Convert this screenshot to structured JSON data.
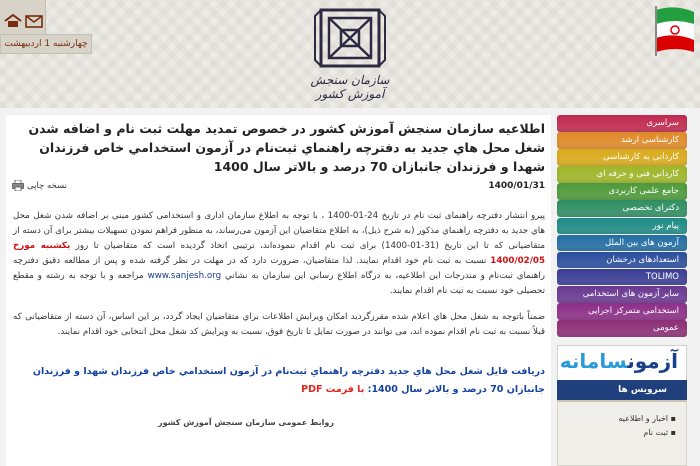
{
  "header": {
    "date": "چهارشنبه 1 اردیبهشت",
    "logo_text": "سازمان سنجش آموزش کشور",
    "icons": [
      "home-icon",
      "mail-icon",
      "flag-icon"
    ]
  },
  "sidebar": {
    "items": [
      {
        "label": "سراسری",
        "color": "#c12a50"
      },
      {
        "label": "کارشناسی ارشد",
        "color": "#e08a2a"
      },
      {
        "label": "کاردانی به کارشناسی",
        "color": "#d9aa1c"
      },
      {
        "label": "کاردانی فنی و حرفه ای",
        "color": "#9fb62a"
      },
      {
        "label": "جامع علمی کاربردی",
        "color": "#4e9a3a"
      },
      {
        "label": "دکترای تخصصی",
        "color": "#2f8f63"
      },
      {
        "label": "پیام نور",
        "color": "#1f8c86"
      },
      {
        "label": "آزمون های بین الملل",
        "color": "#246ea3"
      },
      {
        "label": "استعدادهای درخشان",
        "color": "#2b4f9e"
      },
      {
        "label": "TOLIMO",
        "color": "#3a3e94"
      },
      {
        "label": "سایر آزمون های استخدامی",
        "color": "#6a3a92"
      },
      {
        "label": "استخدامی متمرکز اجرایی",
        "color": "#8d2f88"
      },
      {
        "label": "عمومی",
        "color": "#8d2f78"
      }
    ],
    "ad_text_part1": "آزمون",
    "ad_text_part2": "سامانه",
    "services_title": "سرویس ها",
    "service_links": [
      "اخبار و اطلاعیه",
      "ثبت نام"
    ]
  },
  "article": {
    "title": "اطلاعیه سازمان سنجش آموزش کشور در خصوص تمدید مهلت ثبت نام و اضافه شدن شغل محل هاي جديد به دفترچه راهنماي ثبت‌نام در آزمون استخدامي خاص فرزندان شهدا و فرزندان جانبازان 70 درصد و بالاتر سال 1400",
    "print_label": "نسخه چاپی",
    "date": "1400/01/31",
    "para1_a": "پیرو انتشار دفترچه راهنمای ثبت نام در تاریخ 24-01-1400 ، با توجه به اطلاع سازمان اداری و استخدامی کشور مبنی بر اضافه شدن شغل محل هاي جديد به دفترچه راهنماي مذکور (به شرح ذيل)، به اطلاع متقاضیان این آزمون می‌رساند، به منظور فراهم نمودن تسهیلات بیشتر برای آن دسته از متقاضیانی که تا این تاریخ (31-01-1400) برای ثبت نام اقدام ننموده‌اند، ترتیبی اتخاذ گردیده است که متقاضیان تا روز",
    "para1_highlight": "يکشنبه مورخ 1400/02/05",
    "para1_b": "نسبت به ثبت نام خود اقدام نمايند. لذا متقاضیان، ضرورت دارد که در مهلت در نظر گرفته شده و پس از مطالعه دقيق دفترچه راهنماي ثبت‌نام و مندرجات اين اطلاعيه، به درگاه اطلاع رساني اين سازمان به نشاني",
    "para1_link": "www.sanjesh.org",
    "para1_c": "مراجعه و با توجه به رشته و مقطع تحصیلی خود نسبت به ثبت نام اقدام نمایند.",
    "para2": "ضمناً باتوجه به شغل محل هاي اعلام شده مقررگرديد امکان ويرايش اطلاعات براي متقاضيان ايجاد گردد، بر اين اساس، آن دسته از متقاضیانی که قبلاً نسبت به ثبت نام اقدام نموده اند، می توانند در صورت تمایل تا تاریخ فوق، نسبت به ویرایش کد شغل محل انتخابی خود اقدام نمایند.",
    "download_text": "دريافت فایل شغل محل هاي جديد  دفترچه راهنماي ثبت‌نام در آزمون استخدامي خاص فرزندان شهدا و فرزندان جانبازان 70 درصد و بالاتر سال 1400:",
    "download_pdf": "با فرمت PDF",
    "footer": "روابط عمومی سازمان سنجش آموزش کشور"
  }
}
